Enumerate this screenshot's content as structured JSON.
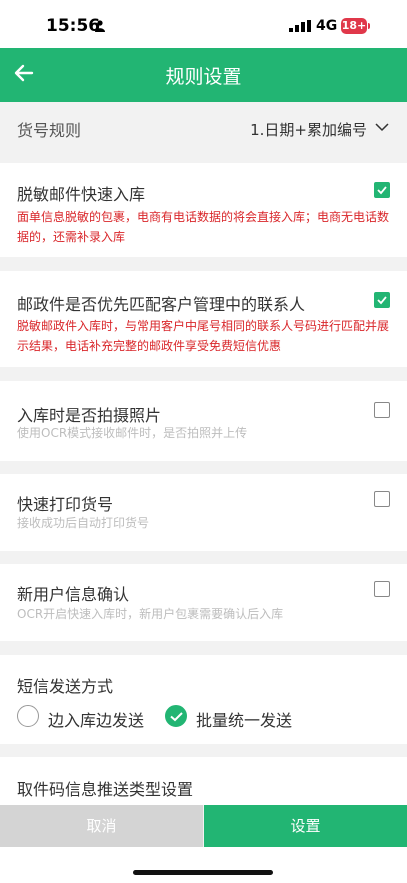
{
  "status": {
    "time": "15:56",
    "network": "4G",
    "battery": "18+"
  },
  "nav": {
    "title": "规则设置"
  },
  "cargo_rule": {
    "label": "货号规则",
    "value": "1.日期+累加编号"
  },
  "settings": [
    {
      "title": "脱敏邮件快速入库",
      "desc": "面单信息脱敏的包裹，电商有电话数据的将会直接入库；电商无电话数据的，还需补录入库",
      "checked": true
    },
    {
      "title": "邮政件是否优先匹配客户管理中的联系人",
      "desc": "脱敏邮政件入库时，与常用客户中尾号相同的联系人号码进行匹配并展示结果，电话补充完整的邮政件享受免费短信优惠",
      "checked": true
    },
    {
      "title": "入库时是否拍摄照片",
      "desc": "使用OCR模式接收邮件时，是否拍照并上传",
      "checked": false
    },
    {
      "title": "快速打印货号",
      "desc": "接收成功后自动打印货号",
      "checked": false
    },
    {
      "title": "新用户信息确认",
      "desc": "OCR开启快速入库时，新用户包裹需要确认后入库",
      "checked": false
    }
  ],
  "sms": {
    "label": "短信发送方式",
    "option1": "边入库边发送",
    "option2": "批量统一发送",
    "selected": "option2"
  },
  "push": {
    "label": "取件码信息推送类型设置"
  },
  "buttons": {
    "cancel": "取消",
    "confirm": "设置"
  },
  "colors": {
    "accent": "#22b573",
    "warning": "#d9262a"
  }
}
